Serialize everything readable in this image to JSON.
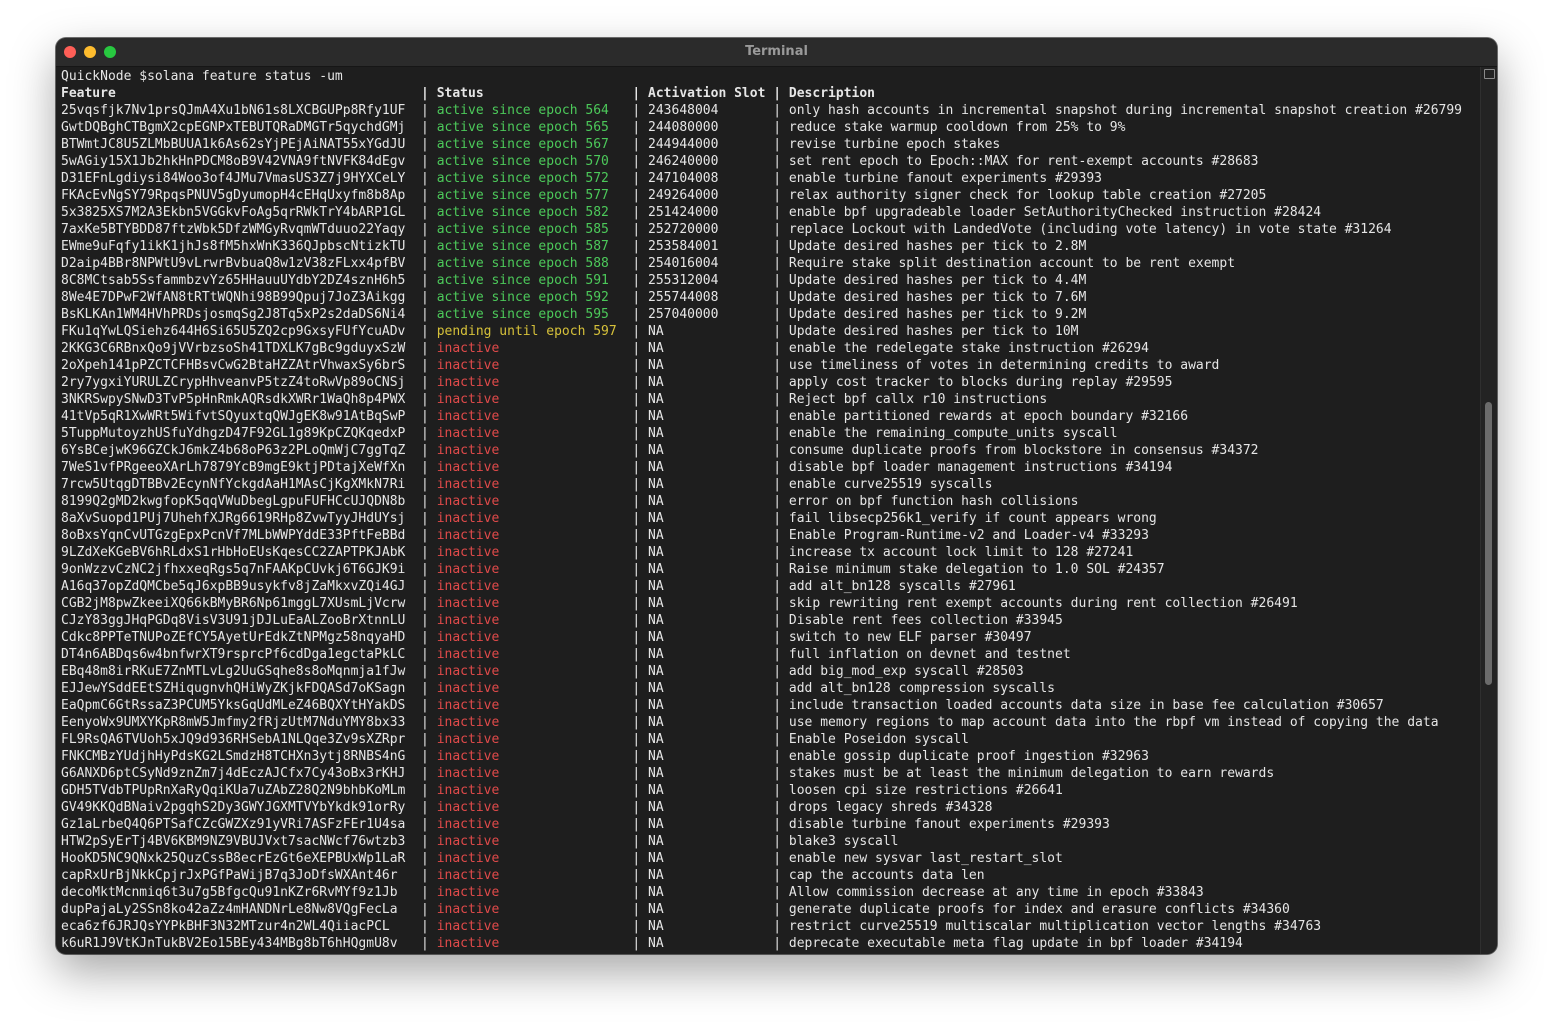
{
  "window": {
    "title": "Terminal"
  },
  "prompt": "QuickNode $solana feature status -um",
  "headers": {
    "feature": "Feature",
    "status": "Status",
    "slot": "Activation Slot",
    "description": "Description"
  },
  "separator": " | ",
  "status_colors": {
    "active": "#4cc95a",
    "pending": "#d6c13a",
    "inactive": "#e04a4a"
  },
  "rows": [
    {
      "feature": "25vqsfjk7Nv1prsQJmA4Xu1bN61s8LXCBGUPp8Rfy1UF",
      "status": "active since epoch 564",
      "slot": "243648004",
      "description": "only hash accounts in incremental snapshot during incremental snapshot creation #26799",
      "state": "active"
    },
    {
      "feature": "GwtDQBghCTBgmX2cpEGNPxTEBUTQRaDMGTr5qychdGMj",
      "status": "active since epoch 565",
      "slot": "244080000",
      "description": "reduce stake warmup cooldown from 25% to 9%",
      "state": "active"
    },
    {
      "feature": "BTWmtJC8U5ZLMbBUUA1k6As62sYjPEjAiNAT55xYGdJU",
      "status": "active since epoch 567",
      "slot": "244944000",
      "description": "revise turbine epoch stakes",
      "state": "active"
    },
    {
      "feature": "5wAGiy15X1Jb2hkHnPDCM8oB9V42VNA9ftNVFK84dEgv",
      "status": "active since epoch 570",
      "slot": "246240000",
      "description": "set rent epoch to Epoch::MAX for rent-exempt accounts #28683",
      "state": "active"
    },
    {
      "feature": "D31EFnLgdiysi84Woo3of4JMu7VmasUS3Z7j9HYXCeLY",
      "status": "active since epoch 572",
      "slot": "247104008",
      "description": "enable turbine fanout experiments #29393",
      "state": "active"
    },
    {
      "feature": "FKAcEvNgSY79RpqsPNUV5gDyumopH4cEHqUxyfm8b8Ap",
      "status": "active since epoch 577",
      "slot": "249264000",
      "description": "relax authority signer check for lookup table creation #27205",
      "state": "active"
    },
    {
      "feature": "5x3825XS7M2A3Ekbn5VGGkvFoAg5qrRWkTrY4bARP1GL",
      "status": "active since epoch 582",
      "slot": "251424000",
      "description": "enable bpf upgradeable loader SetAuthorityChecked instruction #28424",
      "state": "active"
    },
    {
      "feature": "7axKe5BTYBDD87ftzWbk5DfzWMGyRvqmWTduuo22Yaqy",
      "status": "active since epoch 585",
      "slot": "252720000",
      "description": "replace Lockout with LandedVote (including vote latency) in vote state #31264",
      "state": "active"
    },
    {
      "feature": "EWme9uFqfy1ikK1jhJs8fM5hxWnK336QJpbscNtizkTU",
      "status": "active since epoch 587",
      "slot": "253584001",
      "description": "Update desired hashes per tick to 2.8M",
      "state": "active"
    },
    {
      "feature": "D2aip4BBr8NPWtU9vLrwrBvbuaQ8w1zV38zFLxx4pfBV",
      "status": "active since epoch 588",
      "slot": "254016004",
      "description": "Require stake split destination account to be rent exempt",
      "state": "active"
    },
    {
      "feature": "8C8MCtsab5SsfammbzvYz65HHauuUYdbY2DZ4sznH6h5",
      "status": "active since epoch 591",
      "slot": "255312004",
      "description": "Update desired hashes per tick to 4.4M",
      "state": "active"
    },
    {
      "feature": "8We4E7DPwF2WfAN8tRTtWQNhi98B99Qpuj7JoZ3Aikgg",
      "status": "active since epoch 592",
      "slot": "255744008",
      "description": "Update desired hashes per tick to 7.6M",
      "state": "active"
    },
    {
      "feature": "BsKLKAn1WM4HVhPRDsjosmqSg2J8Tq5xP2s2daDS6Ni4",
      "status": "active since epoch 595",
      "slot": "257040000",
      "description": "Update desired hashes per tick to 9.2M",
      "state": "active"
    },
    {
      "feature": "FKu1qYwLQSiehz644H6Si65U5ZQ2cp9GxsyFUfYcuADv",
      "status": "pending until epoch 597",
      "slot": "NA",
      "description": "Update desired hashes per tick to 10M",
      "state": "pending"
    },
    {
      "feature": "2KKG3C6RBnxQo9jVVrbzsoSh41TDXLK7gBc9gduyxSzW",
      "status": "inactive",
      "slot": "NA",
      "description": "enable the redelegate stake instruction #26294",
      "state": "inactive"
    },
    {
      "feature": "2oXpeh141pPZCTCFHBsvCwG2BtaHZZAtrVhwaxSy6brS",
      "status": "inactive",
      "slot": "NA",
      "description": "use timeliness of votes in determining credits to award",
      "state": "inactive"
    },
    {
      "feature": "2ry7ygxiYURULZCrypHhveanvP5tzZ4toRwVp89oCNSj",
      "status": "inactive",
      "slot": "NA",
      "description": "apply cost tracker to blocks during replay #29595",
      "state": "inactive"
    },
    {
      "feature": "3NKRSwpySNwD3TvP5pHnRmkAQRsdkXWRr1WaQh8p4PWX",
      "status": "inactive",
      "slot": "NA",
      "description": "Reject bpf callx r10 instructions",
      "state": "inactive"
    },
    {
      "feature": "41tVp5qR1XwWRt5WifvtSQyuxtqQWJgEK8w91AtBqSwP",
      "status": "inactive",
      "slot": "NA",
      "description": "enable partitioned rewards at epoch boundary #32166",
      "state": "inactive"
    },
    {
      "feature": "5TuppMutoyzhUSfuYdhgzD47F92GL1g89KpCZQKqedxP",
      "status": "inactive",
      "slot": "NA",
      "description": "enable the remaining_compute_units syscall",
      "state": "inactive"
    },
    {
      "feature": "6YsBCejwK96GZCkJ6mkZ4b68oP63z2PLoQmWjC7ggTqZ",
      "status": "inactive",
      "slot": "NA",
      "description": "consume duplicate proofs from blockstore in consensus #34372",
      "state": "inactive"
    },
    {
      "feature": "7WeS1vfPRgeeoXArLh7879YcB9mgE9ktjPDtajXeWfXn",
      "status": "inactive",
      "slot": "NA",
      "description": "disable bpf loader management instructions #34194",
      "state": "inactive"
    },
    {
      "feature": "7rcw5UtqgDTBBv2EcynNfYckgdAaH1MAsCjKgXMkN7Ri",
      "status": "inactive",
      "slot": "NA",
      "description": "enable curve25519 syscalls",
      "state": "inactive"
    },
    {
      "feature": "8199Q2gMD2kwgfopK5qqVWuDbegLgpuFUFHCcUJQDN8b",
      "status": "inactive",
      "slot": "NA",
      "description": "error on bpf function hash collisions",
      "state": "inactive"
    },
    {
      "feature": "8aXvSuopd1PUj7UhehfXJRg6619RHp8ZvwTyyJHdUYsj",
      "status": "inactive",
      "slot": "NA",
      "description": "fail libsecp256k1_verify if count appears wrong",
      "state": "inactive"
    },
    {
      "feature": "8oBxsYqnCvUTGzgEpxPcnVf7MLbWWPYddE33PftFeBBd",
      "status": "inactive",
      "slot": "NA",
      "description": "Enable Program-Runtime-v2 and Loader-v4 #33293",
      "state": "inactive"
    },
    {
      "feature": "9LZdXeKGeBV6hRLdxS1rHbHoEUsKqesCC2ZAPTPKJAbK",
      "status": "inactive",
      "slot": "NA",
      "description": "increase tx account lock limit to 128 #27241",
      "state": "inactive"
    },
    {
      "feature": "9onWzzvCzNC2jfhxxeqRgs5q7nFAAKpCUvkj6T6GJK9i",
      "status": "inactive",
      "slot": "NA",
      "description": "Raise minimum stake delegation to 1.0 SOL #24357",
      "state": "inactive"
    },
    {
      "feature": "A16q37opZdQMCbe5qJ6xpBB9usykfv8jZaMkxvZQi4GJ",
      "status": "inactive",
      "slot": "NA",
      "description": "add alt_bn128 syscalls #27961",
      "state": "inactive"
    },
    {
      "feature": "CGB2jM8pwZkeeiXQ66kBMyBR6Np61mggL7XUsmLjVcrw",
      "status": "inactive",
      "slot": "NA",
      "description": "skip rewriting rent exempt accounts during rent collection #26491",
      "state": "inactive"
    },
    {
      "feature": "CJzY83ggJHqPGDq8VisV3U91jDJLuEaALZooBrXtnnLU",
      "status": "inactive",
      "slot": "NA",
      "description": "Disable rent fees collection #33945",
      "state": "inactive"
    },
    {
      "feature": "Cdkc8PPTeTNUPoZEfCY5AyetUrEdkZtNPMgz58nqyaHD",
      "status": "inactive",
      "slot": "NA",
      "description": "switch to new ELF parser #30497",
      "state": "inactive"
    },
    {
      "feature": "DT4n6ABDqs6w4bnfwrXT9rsprcPf6cdDga1egctaPkLC",
      "status": "inactive",
      "slot": "NA",
      "description": "full inflation on devnet and testnet",
      "state": "inactive"
    },
    {
      "feature": "EBq48m8irRKuE7ZnMTLvLg2UuGSqhe8s8oMqnmja1fJw",
      "status": "inactive",
      "slot": "NA",
      "description": "add big_mod_exp syscall #28503",
      "state": "inactive"
    },
    {
      "feature": "EJJewYSddEEtSZHiqugnvhQHiWyZKjkFDQASd7oKSagn",
      "status": "inactive",
      "slot": "NA",
      "description": "add alt_bn128 compression syscalls",
      "state": "inactive"
    },
    {
      "feature": "EaQpmC6GtRssaZ3PCUM5YksGqUdMLeZ46BQXYtHYakDS",
      "status": "inactive",
      "slot": "NA",
      "description": "include transaction loaded accounts data size in base fee calculation #30657",
      "state": "inactive"
    },
    {
      "feature": "EenyoWx9UMXYKpR8mW5Jmfmy2fRjzUtM7NduYMY8bx33",
      "status": "inactive",
      "slot": "NA",
      "description": "use memory regions to map account data into the rbpf vm instead of copying the data",
      "state": "inactive"
    },
    {
      "feature": "FL9RsQA6TVUoh5xJQ9d936RHSebA1NLQqe3Zv9sXZRpr",
      "status": "inactive",
      "slot": "NA",
      "description": "Enable Poseidon syscall",
      "state": "inactive"
    },
    {
      "feature": "FNKCMBzYUdjhHyPdsKG2LSmdzH8TCHXn3ytj8RNBS4nG",
      "status": "inactive",
      "slot": "NA",
      "description": "enable gossip duplicate proof ingestion #32963",
      "state": "inactive"
    },
    {
      "feature": "G6ANXD6ptCSyNd9znZm7j4dEczAJCfx7Cy43oBx3rKHJ",
      "status": "inactive",
      "slot": "NA",
      "description": "stakes must be at least the minimum delegation to earn rewards",
      "state": "inactive"
    },
    {
      "feature": "GDH5TVdbTPUpRnXaRyQqiKUa7uZAbZ28Q2N9bhbKoMLm",
      "status": "inactive",
      "slot": "NA",
      "description": "loosen cpi size restrictions #26641",
      "state": "inactive"
    },
    {
      "feature": "GV49KKQdBNaiv2pgqhS2Dy3GWYJGXMTVYbYkdk91orRy",
      "status": "inactive",
      "slot": "NA",
      "description": "drops legacy shreds #34328",
      "state": "inactive"
    },
    {
      "feature": "Gz1aLrbeQ4Q6PTSafCZcGWZXz91yVRi7ASFzFEr1U4sa",
      "status": "inactive",
      "slot": "NA",
      "description": "disable turbine fanout experiments #29393",
      "state": "inactive"
    },
    {
      "feature": "HTW2pSyErTj4BV6KBM9NZ9VBUJVxt7sacNWcf76wtzb3",
      "status": "inactive",
      "slot": "NA",
      "description": "blake3 syscall",
      "state": "inactive"
    },
    {
      "feature": "HooKD5NC9QNxk25QuzCssB8ecrEzGt6eXEPBUxWp1LaR",
      "status": "inactive",
      "slot": "NA",
      "description": "enable new sysvar last_restart_slot",
      "state": "inactive"
    },
    {
      "feature": "capRxUrBjNkkCpjrJxPGfPaWijB7q3JoDfsWXAnt46r",
      "status": "inactive",
      "slot": "NA",
      "description": "cap the accounts data len",
      "state": "inactive"
    },
    {
      "feature": "decoMktMcnmiq6t3u7g5BfgcQu91nKZr6RvMYf9z1Jb",
      "status": "inactive",
      "slot": "NA",
      "description": "Allow commission decrease at any time in epoch #33843",
      "state": "inactive"
    },
    {
      "feature": "dupPajaLy2SSn8ko42aZz4mHANDNrLe8Nw8VQgFecLa",
      "status": "inactive",
      "slot": "NA",
      "description": "generate duplicate proofs for index and erasure conflicts #34360",
      "state": "inactive"
    },
    {
      "feature": "eca6zf6JRJQsYYPkBHF3N32MTzur4n2WL4QiiacPCL",
      "status": "inactive",
      "slot": "NA",
      "description": "restrict curve25519 multiscalar multiplication vector lengths #34763",
      "state": "inactive"
    },
    {
      "feature": "k6uR1J9VtKJnTukBV2Eo15BEy434MBg8bT6hHQgmU8v",
      "status": "inactive",
      "slot": "NA",
      "description": "deprecate executable meta flag update in bpf loader #34194",
      "state": "inactive"
    }
  ]
}
